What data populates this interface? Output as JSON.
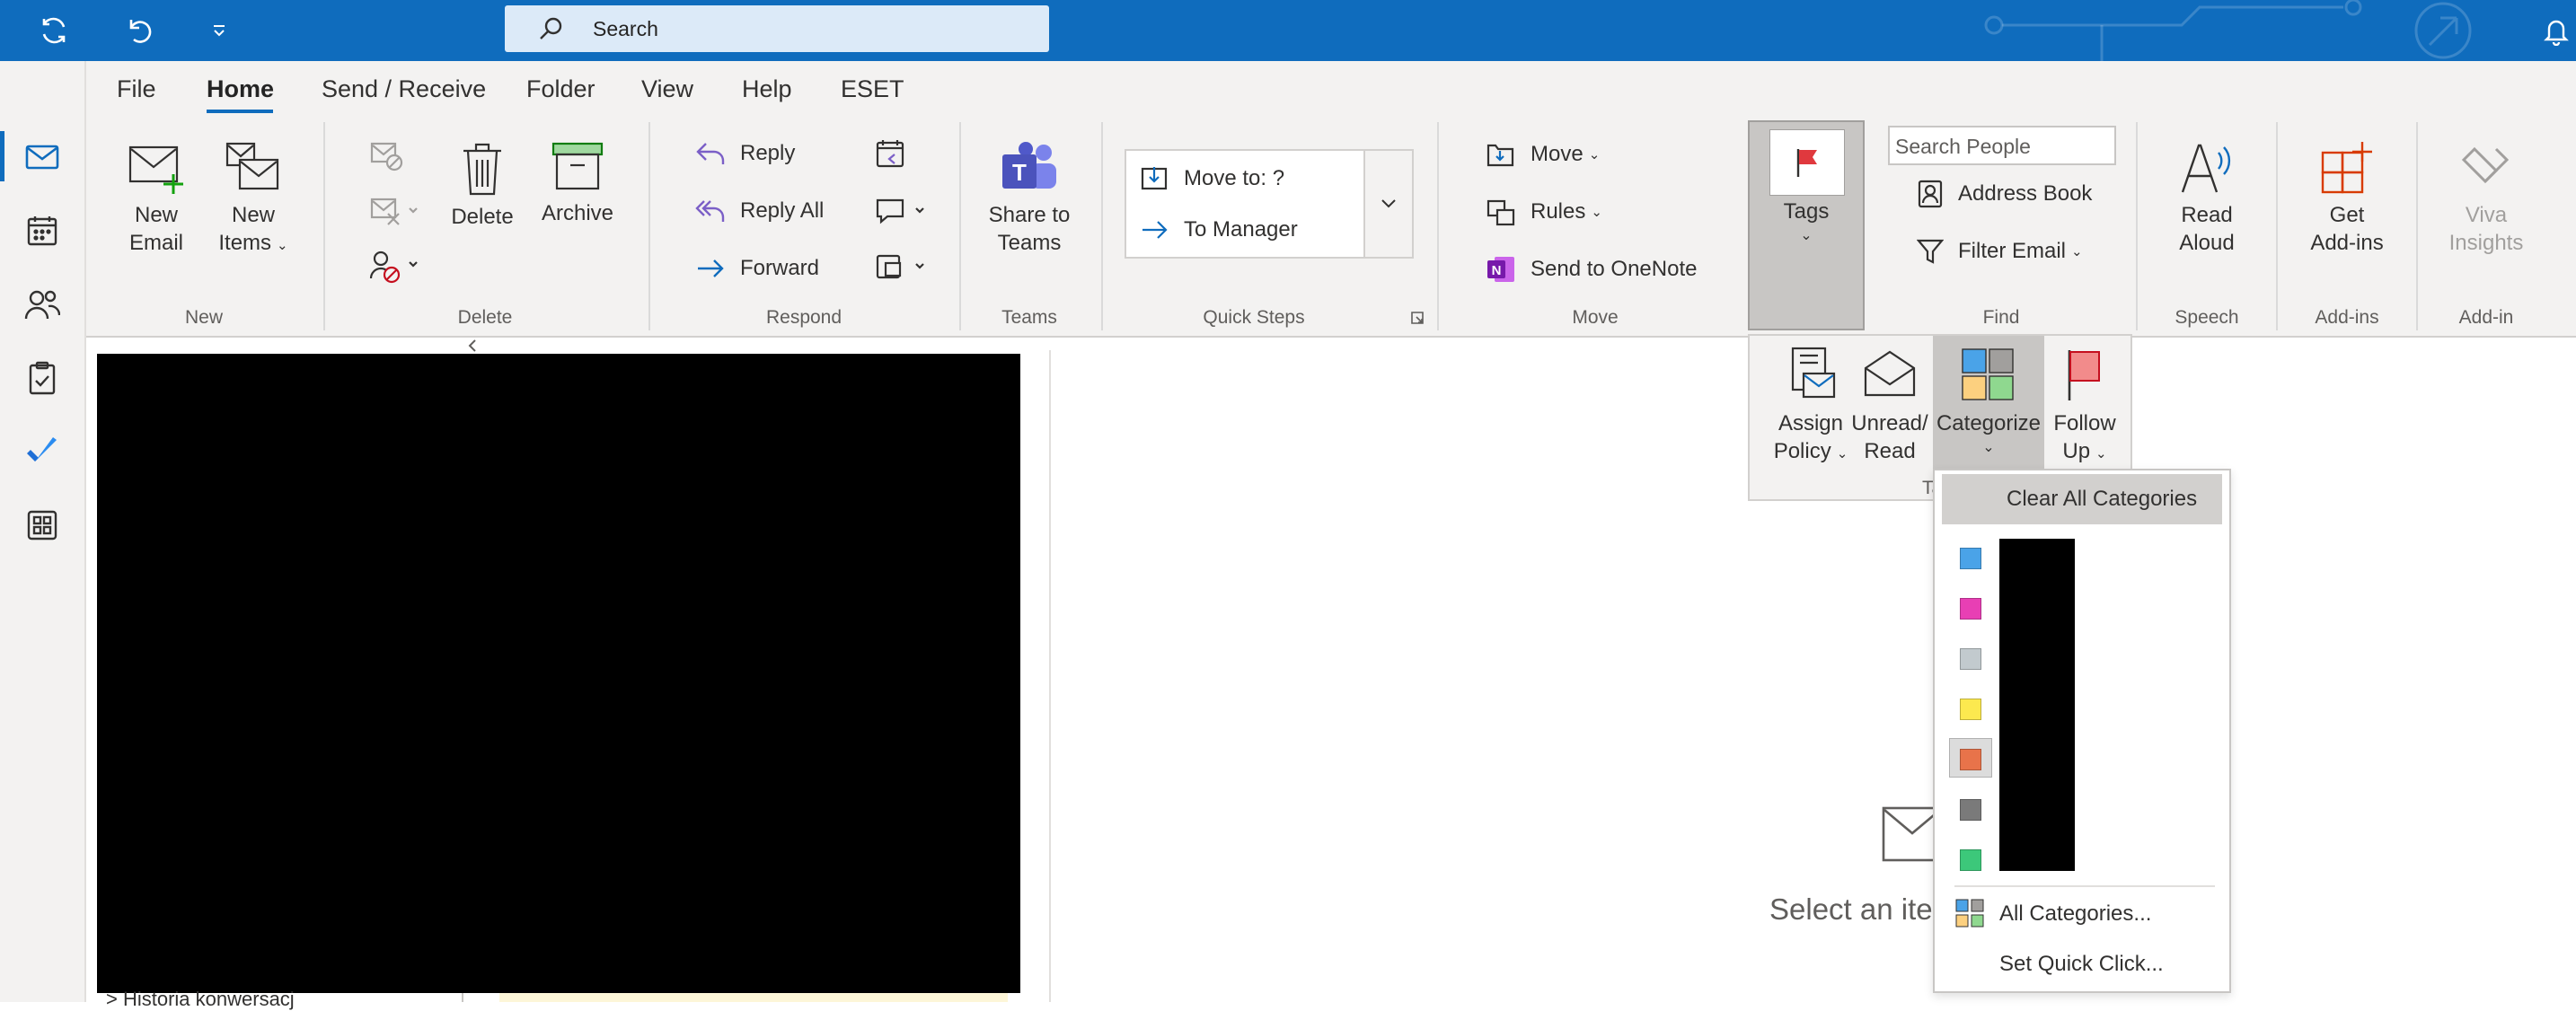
{
  "search": {
    "placeholder": "Search"
  },
  "tabs": [
    "File",
    "Home",
    "Send / Receive",
    "Folder",
    "View",
    "Help",
    "ESET"
  ],
  "groups": {
    "new": "New",
    "delete": "Delete",
    "respond": "Respond",
    "teams": "Teams",
    "quicksteps": "Quick Steps",
    "move": "Move",
    "find": "Find",
    "speech": "Speech",
    "addins": "Add-ins",
    "addin": "Add-in"
  },
  "buttons": {
    "new_email": [
      "New",
      "Email"
    ],
    "new_items": [
      "New",
      "Items"
    ],
    "delete": "Delete",
    "archive": "Archive",
    "reply": "Reply",
    "reply_all": "Reply All",
    "forward": "Forward",
    "share_teams": [
      "Share to",
      "Teams"
    ],
    "quick_step_1": "Move to: ?",
    "quick_step_2": "To Manager",
    "move": "Move",
    "rules": "Rules",
    "send_onenote": "Send to OneNote",
    "tags": "Tags",
    "search_people_placeholder": "Search People",
    "address_book": "Address Book",
    "filter_email": "Filter Email",
    "read_aloud": [
      "Read",
      "Aloud"
    ],
    "get_addins": [
      "Get",
      "Add-ins"
    ],
    "viva_insights": [
      "Viva",
      "Insights"
    ]
  },
  "tags_popup": {
    "assign_policy": [
      "Assign",
      "Policy"
    ],
    "unread_read": [
      "Unread/",
      "Read"
    ],
    "categorize": "Categorize",
    "follow_up": [
      "Follow",
      "Up"
    ],
    "group_label_fragment": "Ta"
  },
  "categorize_menu": {
    "clear_all": "Clear All Categories",
    "swatches": [
      "#4aa3e8",
      "#e83fb4",
      "#c2cace",
      "#fce94f",
      "#e8734a",
      "#7a7a7a",
      "#3cc87a"
    ],
    "all_categories": "All Categories...",
    "set_quick_click": "Set Quick Click..."
  },
  "reading_pane": {
    "message": "Select an ite"
  },
  "folder_pane": {
    "bottom_item": "> Historia konwersacj"
  },
  "colors": {
    "accent": "#0f6cbd",
    "ribbon": "#f3f2f1"
  }
}
